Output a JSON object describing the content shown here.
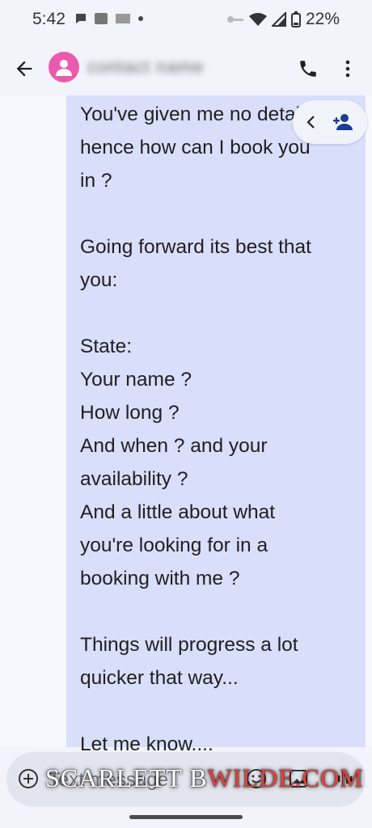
{
  "status_bar": {
    "time": "5:42",
    "battery": "22%",
    "icons": [
      "chat-bubble-icon",
      "photo-icon",
      "cast-icon",
      "dot-icon",
      "key-icon",
      "wifi-icon",
      "signal-icon",
      "battery-icon"
    ]
  },
  "app_bar": {
    "contact_name": "contact name",
    "icons": [
      "back-arrow-icon",
      "person-icon",
      "phone-icon",
      "more-vert-icon"
    ]
  },
  "message": {
    "text": "You've given me no details\nhence how can I book you\nin ?\n\nGoing forward its best that\nyou:\n\nState:\nYour name ?\nHow long ?\nAnd when ? and your\navailability ?\nAnd a little about what\nyou're looking for in a\nbooking with me ?\n\nThings will progress a lot\nquicker that way...\n\nLet me know...."
  },
  "contact_chip": {
    "icons": [
      "chevron-left-icon",
      "add-person-icon"
    ]
  },
  "compose": {
    "placeholder": "Text message",
    "icons": [
      "add-circle-icon",
      "emoji-icon",
      "gallery-icon",
      "voice-icon"
    ]
  },
  "watermark": {
    "part1": "SCARLETT B",
    "part2": "WILDE.COM"
  },
  "colors": {
    "bubble": "#d9defa",
    "avatar": "#ec5ab0",
    "background": "#f7f8fd"
  }
}
